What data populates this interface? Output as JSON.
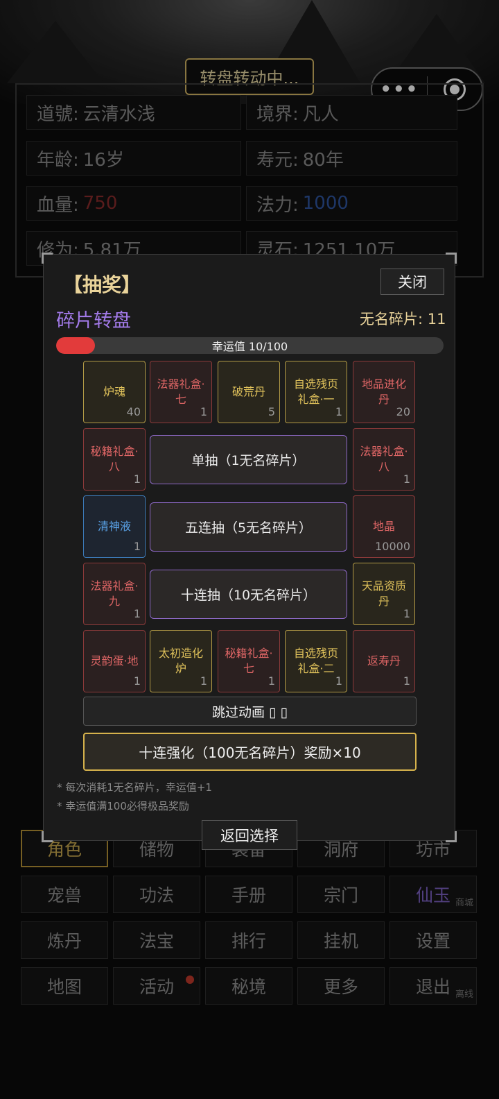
{
  "status_pill": "转盘转动中...",
  "capsule": {
    "more_icon": "more-dots-icon",
    "record_icon": "record-icon"
  },
  "stats": [
    {
      "label": "道號:",
      "value": "云清水浅",
      "color": "#8a8a8a"
    },
    {
      "label": "境界:",
      "value": "凡人",
      "color": "#8a8a8a"
    },
    {
      "label": "年龄:",
      "value": "16岁",
      "color": "#8a8a8a"
    },
    {
      "label": "寿元:",
      "value": "80年",
      "color": "#8a8a8a"
    },
    {
      "label": "血量:",
      "value": "750",
      "color": "#8a2b2b"
    },
    {
      "label": "法力:",
      "value": "1000",
      "color": "#2e55a0"
    },
    {
      "label": "修为:",
      "value": "5.81万",
      "color": "#8a8a8a"
    },
    {
      "label": "灵石:",
      "value": "1251.10万",
      "color": "#8a8a8a"
    }
  ],
  "nav": [
    [
      "角色",
      "储物",
      "装备",
      "洞府",
      "坊市"
    ],
    [
      "宠兽",
      "功法",
      "手册",
      "宗门",
      "仙玉"
    ],
    [
      "炼丹",
      "法宝",
      "排行",
      "挂机",
      "设置"
    ],
    [
      "地图",
      "活动",
      "秘境",
      "更多",
      "退出"
    ]
  ],
  "nav_sub": {
    "shop": "商城",
    "offline": "离线"
  },
  "modal": {
    "title": "【抽奖】",
    "close": "关闭",
    "subtitle": "碎片转盘",
    "fragments": "无名碎片: 11",
    "lucky_text": "幸运值 10/100",
    "lucky_value": 10,
    "lucky_max": 100,
    "prizes": [
      {
        "name": "炉魂",
        "count": "40",
        "tier": "gold"
      },
      {
        "name": "法器礼盒·七",
        "count": "1",
        "tier": "red"
      },
      {
        "name": "破荒丹",
        "count": "5",
        "tier": "gold"
      },
      {
        "name": "自选残页礼盒·一",
        "count": "1",
        "tier": "gold"
      },
      {
        "name": "地品进化丹",
        "count": "20",
        "tier": "red"
      },
      {
        "name": "秘籍礼盒·八",
        "count": "1",
        "tier": "red"
      },
      {
        "name": "法器礼盒·八",
        "count": "1",
        "tier": "red"
      },
      {
        "name": "清神液",
        "count": "1",
        "tier": "blue"
      },
      {
        "name": "地晶",
        "count": "10000",
        "tier": "red"
      },
      {
        "name": "法器礼盒·九",
        "count": "1",
        "tier": "red"
      },
      {
        "name": "天品资质丹",
        "count": "1",
        "tier": "gold"
      },
      {
        "name": "灵韵蛋·地",
        "count": "1",
        "tier": "red"
      },
      {
        "name": "太初造化炉",
        "count": "1",
        "tier": "gold"
      },
      {
        "name": "秘籍礼盒·七",
        "count": "1",
        "tier": "red"
      },
      {
        "name": "自选残页礼盒·二",
        "count": "1",
        "tier": "gold"
      },
      {
        "name": "返寿丹",
        "count": "1",
        "tier": "red"
      }
    ],
    "single_draw": "单抽（1无名碎片）",
    "five_draw": "五连抽（5无名碎片）",
    "ten_draw": "十连抽（10无名碎片）",
    "skip": "跳过动画 ▯ ▯",
    "ten_enhance": "十连强化（100无名碎片）奖励×10",
    "note1": "* 每次消耗1无名碎片，幸运值+1",
    "note2": "* 幸运值满100必得极品奖励",
    "back": "返回选择"
  },
  "colors": {
    "gold": "#e0c25b",
    "red": "#e06666",
    "blue": "#5aa3e8",
    "accent_purple": "#a27ae8"
  }
}
